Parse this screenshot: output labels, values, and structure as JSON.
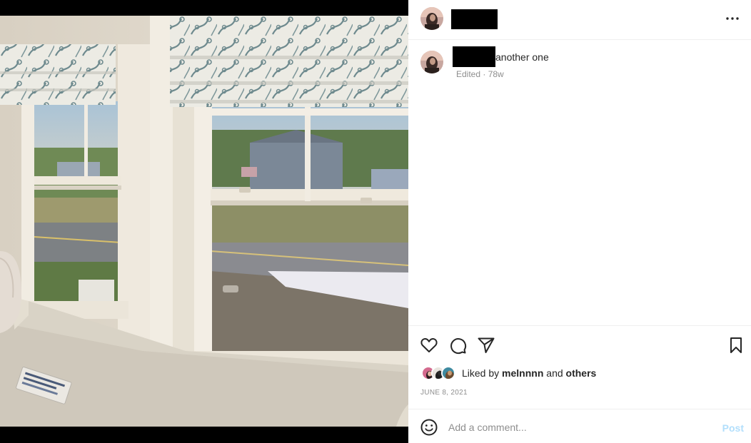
{
  "post": {
    "caption_text": "another one",
    "caption_meta": "Edited · 78w",
    "date": "JUNE 8, 2021"
  },
  "likes": {
    "prefix": "Liked by",
    "user": "melnnnn",
    "joiner": "and",
    "others": "others"
  },
  "comment": {
    "placeholder": "Add a comment...",
    "post_label": "Post"
  },
  "icons": {
    "more": "more-options-icon",
    "like": "heart-icon",
    "comment": "comment-bubble-icon",
    "share": "paper-plane-icon",
    "save": "bookmark-icon",
    "emoji": "smiley-icon"
  },
  "colors": {
    "post_button": "#b2dffc",
    "muted_text": "#8e8e8e",
    "divider": "#efefef"
  }
}
